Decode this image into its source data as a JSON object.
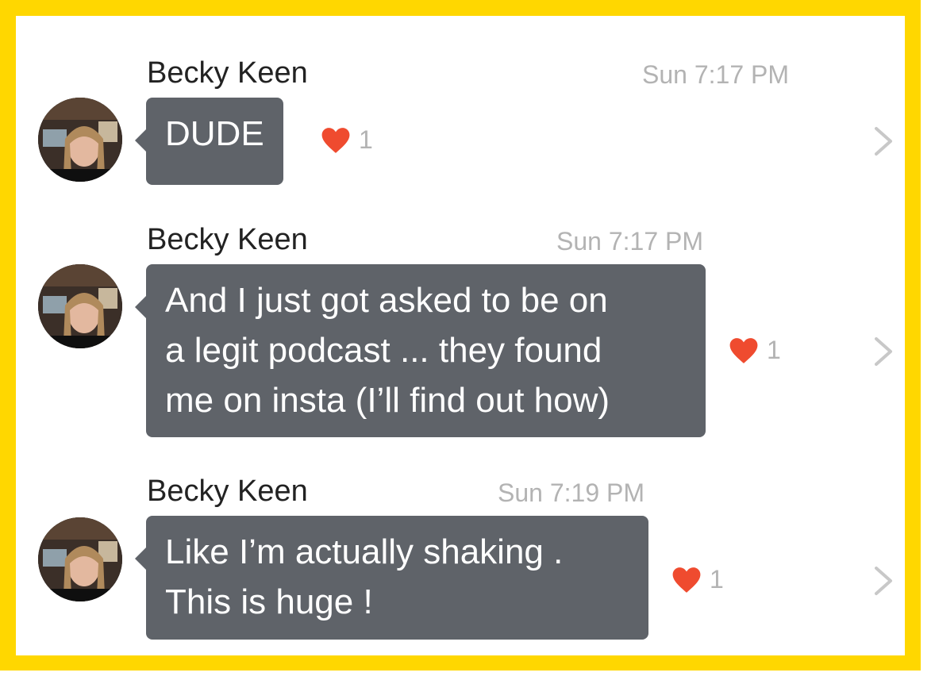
{
  "colors": {
    "frame": "#FFD700",
    "bubble": "#5f6369",
    "heart": "#ef4b2f",
    "meta_text": "#b3b3b3"
  },
  "messages": [
    {
      "sender": "Becky Keen",
      "time": "Sun 7:17 PM",
      "text": "DUDE",
      "reactions": {
        "icon": "heart-icon",
        "count": "1"
      }
    },
    {
      "sender": "Becky Keen",
      "time": "Sun 7:17 PM",
      "text": "And I just got asked to be on\na legit podcast ... they found\nme on insta (I’ll find out how)",
      "reactions": {
        "icon": "heart-icon",
        "count": "1"
      }
    },
    {
      "sender": "Becky Keen",
      "time": "Sun 7:19 PM",
      "text": "Like I’m actually shaking .\nThis is huge !",
      "reactions": {
        "icon": "heart-icon",
        "count": "1"
      }
    }
  ]
}
